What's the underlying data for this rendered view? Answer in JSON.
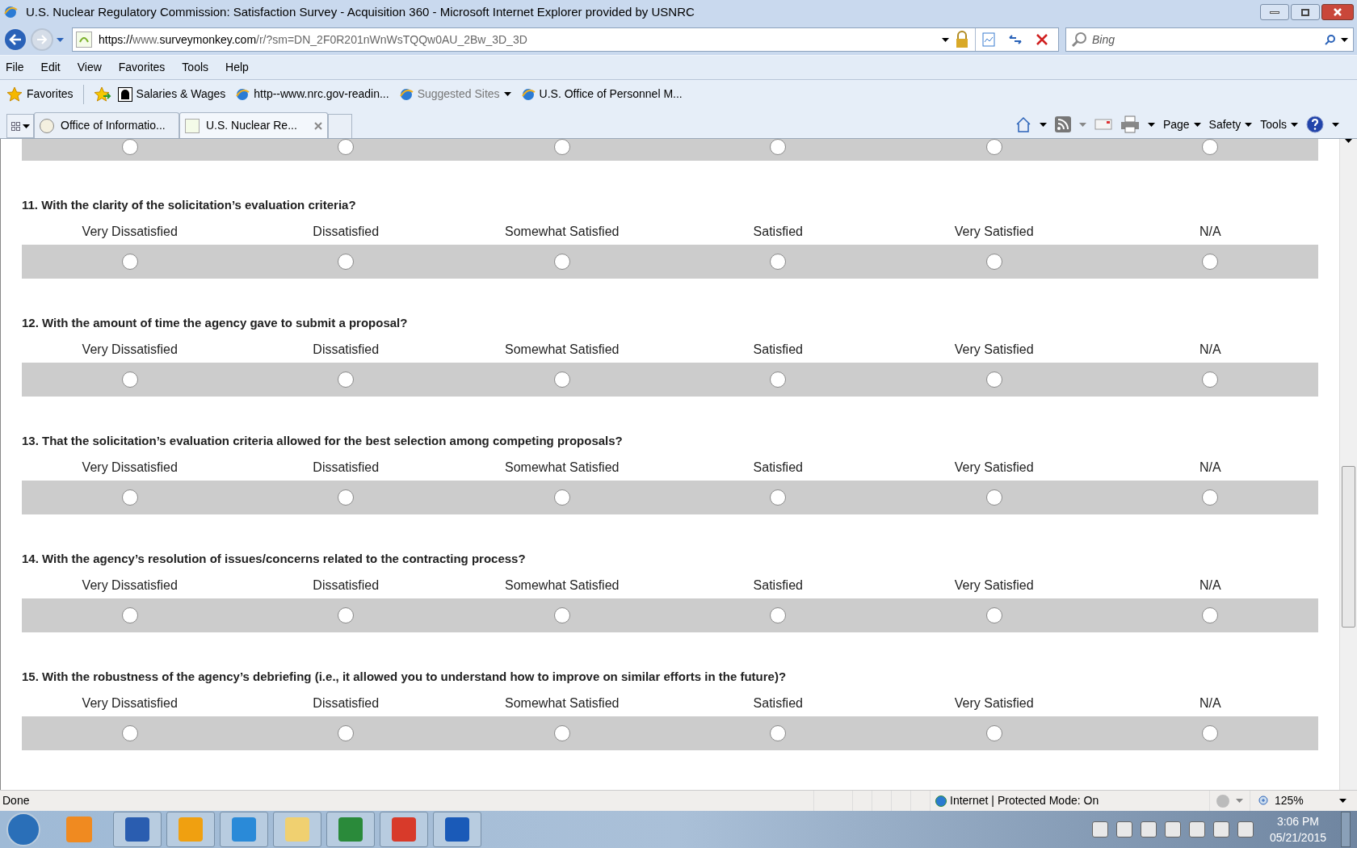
{
  "window": {
    "title": "U.S. Nuclear Regulatory Commission: Satisfaction Survey - Acquisition 360 - Microsoft Internet Explorer provided by USNRC"
  },
  "address_bar": {
    "url_prefix": "https://www.",
    "url_host": "surveymonkey.com",
    "url_path": "/r/?sm=DN_2F0R201nWnWsTQQw0AU_2Bw_3D_3D"
  },
  "search": {
    "placeholder": "Bing"
  },
  "menu": [
    "File",
    "Edit",
    "View",
    "Favorites",
    "Tools",
    "Help"
  ],
  "favorites_bar": {
    "label": "Favorites",
    "items": [
      {
        "label": "Salaries & Wages",
        "disabled": false,
        "dropdown": false
      },
      {
        "label": "http--www.nrc.gov-readin...",
        "disabled": false,
        "dropdown": false
      },
      {
        "label": "Suggested Sites",
        "disabled": true,
        "dropdown": true
      },
      {
        "label": "U.S. Office of Personnel M...",
        "disabled": false,
        "dropdown": false
      }
    ]
  },
  "tabs": [
    {
      "label": "Office of Informatio...",
      "selected": false
    },
    {
      "label": "U.S. Nuclear Re...",
      "selected": true
    }
  ],
  "command_bar": [
    "Page",
    "Safety",
    "Tools"
  ],
  "previous_question_row": [
    {
      "selected": false
    },
    {
      "selected": false
    },
    {
      "selected": false
    },
    {
      "selected": false
    },
    {
      "selected": false
    },
    {
      "selected": false
    }
  ],
  "questions": [
    {
      "title": "11. With the clarity of the solicitation’s evaluation criteria?",
      "options": [
        {
          "label": "Very Dissatisfied",
          "selected": false
        },
        {
          "label": "Dissatisfied",
          "selected": false
        },
        {
          "label": "Somewhat Satisfied",
          "selected": false
        },
        {
          "label": "Satisfied",
          "selected": false
        },
        {
          "label": "Very Satisfied",
          "selected": false
        },
        {
          "label": "N/A",
          "selected": false
        }
      ]
    },
    {
      "title": "12. With the amount of time the agency gave to submit a proposal?",
      "options": [
        {
          "label": "Very Dissatisfied",
          "selected": false
        },
        {
          "label": "Dissatisfied",
          "selected": false
        },
        {
          "label": "Somewhat Satisfied",
          "selected": false
        },
        {
          "label": "Satisfied",
          "selected": false
        },
        {
          "label": "Very Satisfied",
          "selected": false
        },
        {
          "label": "N/A",
          "selected": false
        }
      ]
    },
    {
      "title": "13. That the solicitation’s evaluation criteria allowed for the best selection among competing proposals?",
      "options": [
        {
          "label": "Very Dissatisfied",
          "selected": false
        },
        {
          "label": "Dissatisfied",
          "selected": false
        },
        {
          "label": "Somewhat Satisfied",
          "selected": false
        },
        {
          "label": "Satisfied",
          "selected": false
        },
        {
          "label": "Very Satisfied",
          "selected": false
        },
        {
          "label": "N/A",
          "selected": false
        }
      ]
    },
    {
      "title": "14. With the agency’s resolution of issues/concerns related to the contracting process?",
      "options": [
        {
          "label": "Very Dissatisfied",
          "selected": false
        },
        {
          "label": "Dissatisfied",
          "selected": false
        },
        {
          "label": "Somewhat Satisfied",
          "selected": false
        },
        {
          "label": "Satisfied",
          "selected": false
        },
        {
          "label": "Very Satisfied",
          "selected": false
        },
        {
          "label": "N/A",
          "selected": false
        }
      ]
    },
    {
      "title": "15. With the robustness of the agency’s debriefing (i.e., it allowed you to understand how to improve on similar efforts in the future)?",
      "options": [
        {
          "label": "Very Dissatisfied",
          "selected": false
        },
        {
          "label": "Dissatisfied",
          "selected": false
        },
        {
          "label": "Somewhat Satisfied",
          "selected": false
        },
        {
          "label": "Satisfied",
          "selected": false
        },
        {
          "label": "Very Satisfied",
          "selected": false
        },
        {
          "label": "N/A",
          "selected": false
        }
      ]
    }
  ],
  "status_bar": {
    "status": "Done",
    "zone": "Internet | Protected Mode: On",
    "zoom": "125%"
  },
  "taskbar": {
    "time": "3:06 PM",
    "date": "05/21/2015"
  }
}
